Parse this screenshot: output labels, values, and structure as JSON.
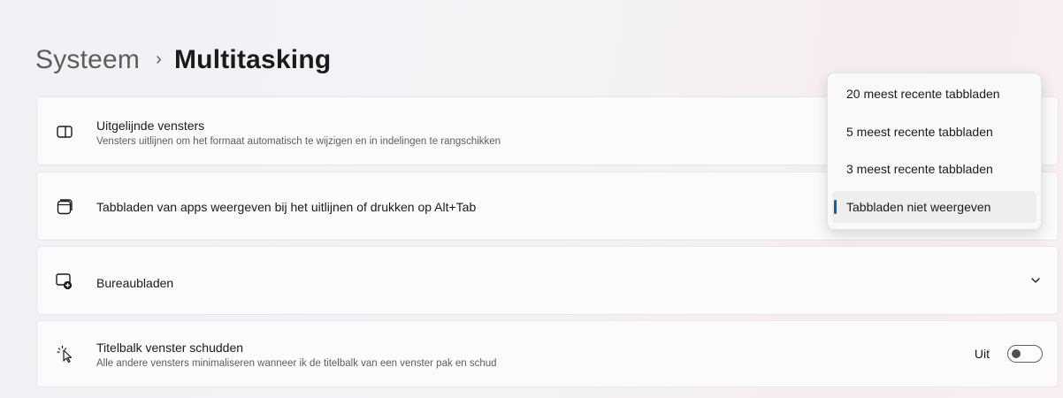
{
  "breadcrumb": {
    "parent": "Systeem",
    "separator": "›",
    "current": "Multitasking"
  },
  "settings": {
    "snap": {
      "title": "Uitgelijnde vensters",
      "subtitle": "Vensters uitlijnen om het formaat automatisch te wijzigen en in indelingen te rangschikken",
      "icon": "snap-windows-icon"
    },
    "tabs": {
      "title": "Tabbladen van apps weergeven bij het uitlijnen of drukken op Alt+Tab",
      "icon": "app-tabs-icon"
    },
    "desktops": {
      "title": "Bureaubladen",
      "icon": "virtual-desktops-icon",
      "expand_icon": "chevron-down-icon"
    },
    "shake": {
      "title": "Titelbalk venster schudden",
      "subtitle": "Alle andere vensters minimaliseren wanneer ik de titelbalk van een venster pak en schud",
      "icon": "title-bar-shake-icon",
      "toggle_label": "Uit",
      "toggle_state": "off"
    }
  },
  "dropdown": {
    "options": [
      "20 meest recente tabbladen",
      "5 meest recente tabbladen",
      "3 meest recente tabbladen",
      "Tabbladen niet weergeven"
    ],
    "selected_index": 3,
    "accent_color": "#0a5fb4"
  }
}
